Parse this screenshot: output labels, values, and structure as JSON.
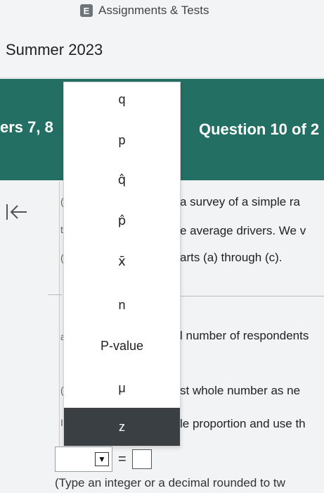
{
  "header": {
    "badge": "E",
    "breadcrumb": "Assignments & Tests",
    "term": "Summer 2023"
  },
  "band": {
    "left_text": "ers 7, 8",
    "right_text": "Question 10 of 2"
  },
  "question": {
    "lines": [
      "a survey of a simple ra",
      "e average drivers. We v",
      "arts (a) through (c).",
      "l number of respondents",
      "st whole number as ne",
      "le proportion and use th"
    ]
  },
  "left_fragments": [
    "(",
    "t",
    "(",
    "a",
    "(",
    "I"
  ],
  "dropdown": {
    "options": [
      "q",
      "p",
      "q̂",
      "p̂",
      "x̄",
      "n",
      "P-value",
      "μ"
    ],
    "selected": "z"
  },
  "answer": {
    "arrow": "▼",
    "equals": "=",
    "hint": "(Type an integer or a decimal rounded to tw"
  }
}
